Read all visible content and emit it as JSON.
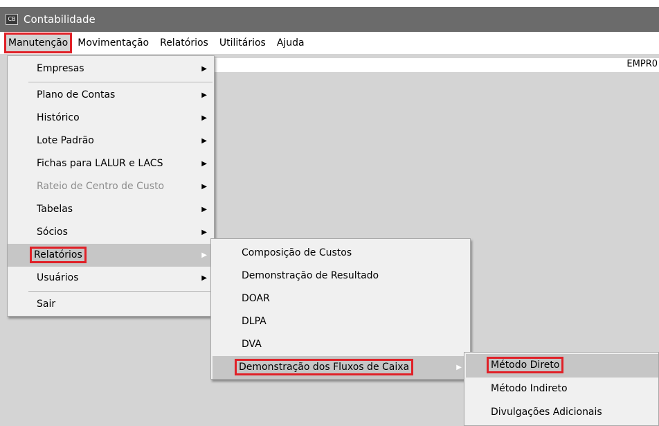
{
  "window": {
    "title": "Contabilidade",
    "icon": "app-logo-icon",
    "icon_text": "CB"
  },
  "menubar": {
    "items": [
      "Manutenção",
      "Movimentação",
      "Relatórios",
      "Utilitários",
      "Ajuda"
    ]
  },
  "workarea": {
    "company_label": "EMPR0"
  },
  "menu_main": {
    "items": [
      {
        "label": "Empresas"
      },
      {
        "label": "Plano de Contas"
      },
      {
        "label": "Histórico"
      },
      {
        "label": "Lote Padrão"
      },
      {
        "label": "Fichas para LALUR e LACS"
      },
      {
        "label": "Rateio de Centro de Custo"
      },
      {
        "label": "Tabelas"
      },
      {
        "label": "Sócios"
      },
      {
        "label": "Relatórios"
      },
      {
        "label": "Usuários"
      },
      {
        "label": "Sair"
      }
    ]
  },
  "menu_relatorios": {
    "items": [
      {
        "label": "Composição de Custos"
      },
      {
        "label": "Demonstração de Resultado"
      },
      {
        "label": "DOAR"
      },
      {
        "label": "DLPA"
      },
      {
        "label": "DVA"
      },
      {
        "label": "Demonstração dos Fluxos de Caixa"
      }
    ]
  },
  "menu_fluxo": {
    "items": [
      {
        "label": "Método Direto"
      },
      {
        "label": "Método Indireto"
      },
      {
        "label": "Divulgações Adicionais"
      }
    ]
  },
  "colors": {
    "titlebar": "#6b6b6b",
    "menu_bg": "#f0f0f0",
    "workarea": "#d4d4d4",
    "highlight": "#e02027",
    "active_item": "#c6c6c6"
  },
  "icons": {
    "submenu_arrow": "triangle-right-icon"
  }
}
